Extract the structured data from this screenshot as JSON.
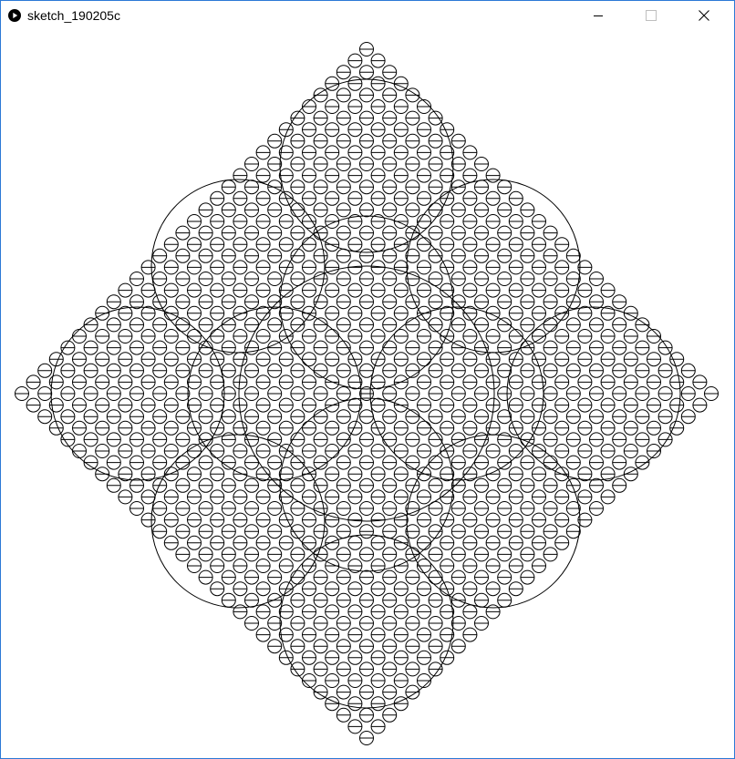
{
  "window": {
    "title": "sketch_190205c",
    "app_icon": "play-icon",
    "controls": {
      "minimize_icon": "minimize-icon",
      "maximize_icon": "maximize-icon",
      "close_icon": "close-icon"
    },
    "border_color": "#2b79d6"
  },
  "sketch": {
    "shape": "diamond",
    "stroke_color": "#000000",
    "background_color": "#ffffff",
    "motif": "circle-with-horizontal-diameter"
  }
}
